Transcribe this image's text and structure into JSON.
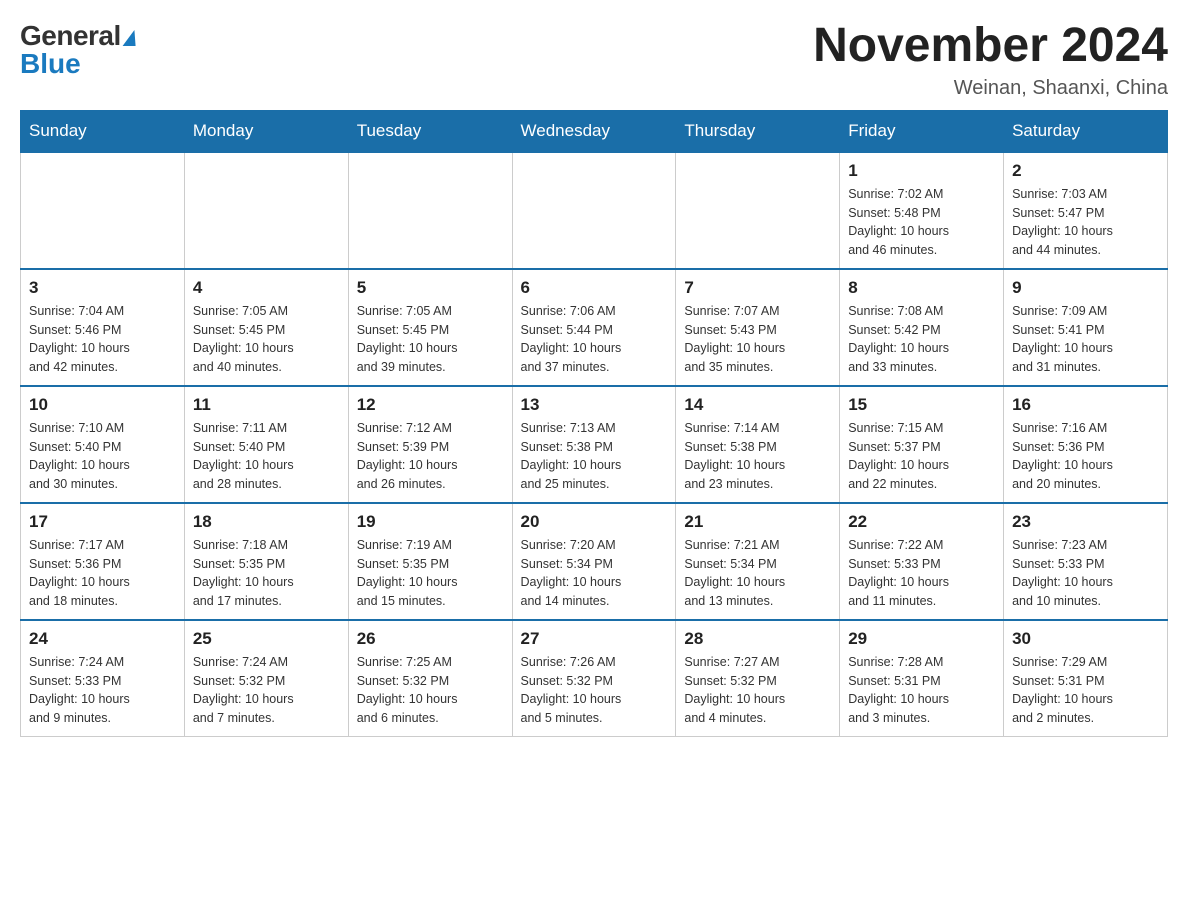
{
  "header": {
    "logo_general": "General",
    "logo_blue": "Blue",
    "month_title": "November 2024",
    "location": "Weinan, Shaanxi, China"
  },
  "weekdays": [
    "Sunday",
    "Monday",
    "Tuesday",
    "Wednesday",
    "Thursday",
    "Friday",
    "Saturday"
  ],
  "weeks": [
    {
      "days": [
        {
          "number": "",
          "info": ""
        },
        {
          "number": "",
          "info": ""
        },
        {
          "number": "",
          "info": ""
        },
        {
          "number": "",
          "info": ""
        },
        {
          "number": "",
          "info": ""
        },
        {
          "number": "1",
          "info": "Sunrise: 7:02 AM\nSunset: 5:48 PM\nDaylight: 10 hours\nand 46 minutes."
        },
        {
          "number": "2",
          "info": "Sunrise: 7:03 AM\nSunset: 5:47 PM\nDaylight: 10 hours\nand 44 minutes."
        }
      ]
    },
    {
      "days": [
        {
          "number": "3",
          "info": "Sunrise: 7:04 AM\nSunset: 5:46 PM\nDaylight: 10 hours\nand 42 minutes."
        },
        {
          "number": "4",
          "info": "Sunrise: 7:05 AM\nSunset: 5:45 PM\nDaylight: 10 hours\nand 40 minutes."
        },
        {
          "number": "5",
          "info": "Sunrise: 7:05 AM\nSunset: 5:45 PM\nDaylight: 10 hours\nand 39 minutes."
        },
        {
          "number": "6",
          "info": "Sunrise: 7:06 AM\nSunset: 5:44 PM\nDaylight: 10 hours\nand 37 minutes."
        },
        {
          "number": "7",
          "info": "Sunrise: 7:07 AM\nSunset: 5:43 PM\nDaylight: 10 hours\nand 35 minutes."
        },
        {
          "number": "8",
          "info": "Sunrise: 7:08 AM\nSunset: 5:42 PM\nDaylight: 10 hours\nand 33 minutes."
        },
        {
          "number": "9",
          "info": "Sunrise: 7:09 AM\nSunset: 5:41 PM\nDaylight: 10 hours\nand 31 minutes."
        }
      ]
    },
    {
      "days": [
        {
          "number": "10",
          "info": "Sunrise: 7:10 AM\nSunset: 5:40 PM\nDaylight: 10 hours\nand 30 minutes."
        },
        {
          "number": "11",
          "info": "Sunrise: 7:11 AM\nSunset: 5:40 PM\nDaylight: 10 hours\nand 28 minutes."
        },
        {
          "number": "12",
          "info": "Sunrise: 7:12 AM\nSunset: 5:39 PM\nDaylight: 10 hours\nand 26 minutes."
        },
        {
          "number": "13",
          "info": "Sunrise: 7:13 AM\nSunset: 5:38 PM\nDaylight: 10 hours\nand 25 minutes."
        },
        {
          "number": "14",
          "info": "Sunrise: 7:14 AM\nSunset: 5:38 PM\nDaylight: 10 hours\nand 23 minutes."
        },
        {
          "number": "15",
          "info": "Sunrise: 7:15 AM\nSunset: 5:37 PM\nDaylight: 10 hours\nand 22 minutes."
        },
        {
          "number": "16",
          "info": "Sunrise: 7:16 AM\nSunset: 5:36 PM\nDaylight: 10 hours\nand 20 minutes."
        }
      ]
    },
    {
      "days": [
        {
          "number": "17",
          "info": "Sunrise: 7:17 AM\nSunset: 5:36 PM\nDaylight: 10 hours\nand 18 minutes."
        },
        {
          "number": "18",
          "info": "Sunrise: 7:18 AM\nSunset: 5:35 PM\nDaylight: 10 hours\nand 17 minutes."
        },
        {
          "number": "19",
          "info": "Sunrise: 7:19 AM\nSunset: 5:35 PM\nDaylight: 10 hours\nand 15 minutes."
        },
        {
          "number": "20",
          "info": "Sunrise: 7:20 AM\nSunset: 5:34 PM\nDaylight: 10 hours\nand 14 minutes."
        },
        {
          "number": "21",
          "info": "Sunrise: 7:21 AM\nSunset: 5:34 PM\nDaylight: 10 hours\nand 13 minutes."
        },
        {
          "number": "22",
          "info": "Sunrise: 7:22 AM\nSunset: 5:33 PM\nDaylight: 10 hours\nand 11 minutes."
        },
        {
          "number": "23",
          "info": "Sunrise: 7:23 AM\nSunset: 5:33 PM\nDaylight: 10 hours\nand 10 minutes."
        }
      ]
    },
    {
      "days": [
        {
          "number": "24",
          "info": "Sunrise: 7:24 AM\nSunset: 5:33 PM\nDaylight: 10 hours\nand 9 minutes."
        },
        {
          "number": "25",
          "info": "Sunrise: 7:24 AM\nSunset: 5:32 PM\nDaylight: 10 hours\nand 7 minutes."
        },
        {
          "number": "26",
          "info": "Sunrise: 7:25 AM\nSunset: 5:32 PM\nDaylight: 10 hours\nand 6 minutes."
        },
        {
          "number": "27",
          "info": "Sunrise: 7:26 AM\nSunset: 5:32 PM\nDaylight: 10 hours\nand 5 minutes."
        },
        {
          "number": "28",
          "info": "Sunrise: 7:27 AM\nSunset: 5:32 PM\nDaylight: 10 hours\nand 4 minutes."
        },
        {
          "number": "29",
          "info": "Sunrise: 7:28 AM\nSunset: 5:31 PM\nDaylight: 10 hours\nand 3 minutes."
        },
        {
          "number": "30",
          "info": "Sunrise: 7:29 AM\nSunset: 5:31 PM\nDaylight: 10 hours\nand 2 minutes."
        }
      ]
    }
  ]
}
